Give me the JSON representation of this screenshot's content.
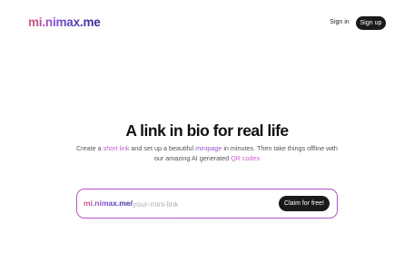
{
  "header": {
    "logo": "mi.nimax.me",
    "signin_label": "Sign in",
    "signup_label": "Sign up"
  },
  "hero": {
    "headline": "A link in bio for real life",
    "subtitle": {
      "part1": "Create a ",
      "short_link": "short link",
      "part2": " and set up a beautiful ",
      "minipage": "minipage",
      "part3": " in minutes. Then take things offline with our amazing AI generated ",
      "qr_codes": "QR codes"
    }
  },
  "claim": {
    "prefix": "mi.nimax.me/",
    "placeholder": "your-mini-link",
    "value": "",
    "button_label": "Claim for free!"
  },
  "colors": {
    "accent_gradient_start": "#e0556f",
    "accent_gradient_mid": "#8b4fd6",
    "accent_gradient_end": "#3a2a8c",
    "highlight": "#c45fcf",
    "dark_button": "#1a1a1a"
  }
}
